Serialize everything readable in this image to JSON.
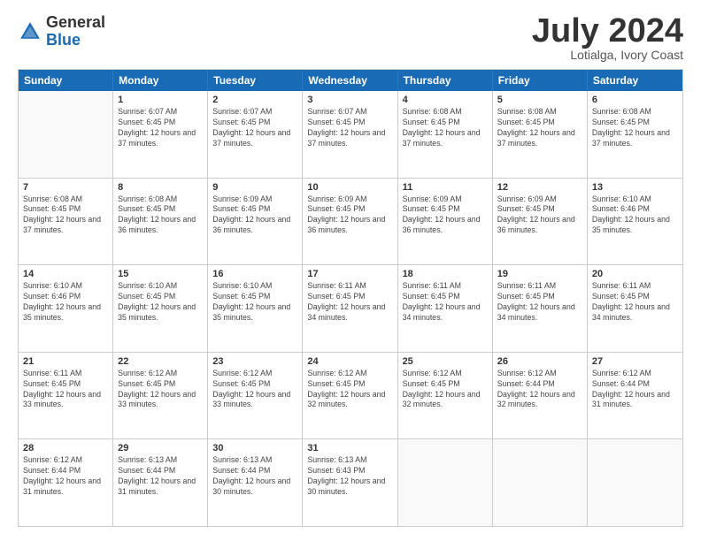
{
  "header": {
    "logo_general": "General",
    "logo_blue": "Blue",
    "month_title": "July 2024",
    "location": "Lotialga, Ivory Coast"
  },
  "calendar": {
    "days_of_week": [
      "Sunday",
      "Monday",
      "Tuesday",
      "Wednesday",
      "Thursday",
      "Friday",
      "Saturday"
    ],
    "weeks": [
      [
        {
          "day": "",
          "sunrise": "",
          "sunset": "",
          "daylight": ""
        },
        {
          "day": "1",
          "sunrise": "Sunrise: 6:07 AM",
          "sunset": "Sunset: 6:45 PM",
          "daylight": "Daylight: 12 hours and 37 minutes."
        },
        {
          "day": "2",
          "sunrise": "Sunrise: 6:07 AM",
          "sunset": "Sunset: 6:45 PM",
          "daylight": "Daylight: 12 hours and 37 minutes."
        },
        {
          "day": "3",
          "sunrise": "Sunrise: 6:07 AM",
          "sunset": "Sunset: 6:45 PM",
          "daylight": "Daylight: 12 hours and 37 minutes."
        },
        {
          "day": "4",
          "sunrise": "Sunrise: 6:08 AM",
          "sunset": "Sunset: 6:45 PM",
          "daylight": "Daylight: 12 hours and 37 minutes."
        },
        {
          "day": "5",
          "sunrise": "Sunrise: 6:08 AM",
          "sunset": "Sunset: 6:45 PM",
          "daylight": "Daylight: 12 hours and 37 minutes."
        },
        {
          "day": "6",
          "sunrise": "Sunrise: 6:08 AM",
          "sunset": "Sunset: 6:45 PM",
          "daylight": "Daylight: 12 hours and 37 minutes."
        }
      ],
      [
        {
          "day": "7",
          "sunrise": "Sunrise: 6:08 AM",
          "sunset": "Sunset: 6:45 PM",
          "daylight": "Daylight: 12 hours and 37 minutes."
        },
        {
          "day": "8",
          "sunrise": "Sunrise: 6:08 AM",
          "sunset": "Sunset: 6:45 PM",
          "daylight": "Daylight: 12 hours and 36 minutes."
        },
        {
          "day": "9",
          "sunrise": "Sunrise: 6:09 AM",
          "sunset": "Sunset: 6:45 PM",
          "daylight": "Daylight: 12 hours and 36 minutes."
        },
        {
          "day": "10",
          "sunrise": "Sunrise: 6:09 AM",
          "sunset": "Sunset: 6:45 PM",
          "daylight": "Daylight: 12 hours and 36 minutes."
        },
        {
          "day": "11",
          "sunrise": "Sunrise: 6:09 AM",
          "sunset": "Sunset: 6:45 PM",
          "daylight": "Daylight: 12 hours and 36 minutes."
        },
        {
          "day": "12",
          "sunrise": "Sunrise: 6:09 AM",
          "sunset": "Sunset: 6:45 PM",
          "daylight": "Daylight: 12 hours and 36 minutes."
        },
        {
          "day": "13",
          "sunrise": "Sunrise: 6:10 AM",
          "sunset": "Sunset: 6:46 PM",
          "daylight": "Daylight: 12 hours and 35 minutes."
        }
      ],
      [
        {
          "day": "14",
          "sunrise": "Sunrise: 6:10 AM",
          "sunset": "Sunset: 6:46 PM",
          "daylight": "Daylight: 12 hours and 35 minutes."
        },
        {
          "day": "15",
          "sunrise": "Sunrise: 6:10 AM",
          "sunset": "Sunset: 6:45 PM",
          "daylight": "Daylight: 12 hours and 35 minutes."
        },
        {
          "day": "16",
          "sunrise": "Sunrise: 6:10 AM",
          "sunset": "Sunset: 6:45 PM",
          "daylight": "Daylight: 12 hours and 35 minutes."
        },
        {
          "day": "17",
          "sunrise": "Sunrise: 6:11 AM",
          "sunset": "Sunset: 6:45 PM",
          "daylight": "Daylight: 12 hours and 34 minutes."
        },
        {
          "day": "18",
          "sunrise": "Sunrise: 6:11 AM",
          "sunset": "Sunset: 6:45 PM",
          "daylight": "Daylight: 12 hours and 34 minutes."
        },
        {
          "day": "19",
          "sunrise": "Sunrise: 6:11 AM",
          "sunset": "Sunset: 6:45 PM",
          "daylight": "Daylight: 12 hours and 34 minutes."
        },
        {
          "day": "20",
          "sunrise": "Sunrise: 6:11 AM",
          "sunset": "Sunset: 6:45 PM",
          "daylight": "Daylight: 12 hours and 34 minutes."
        }
      ],
      [
        {
          "day": "21",
          "sunrise": "Sunrise: 6:11 AM",
          "sunset": "Sunset: 6:45 PM",
          "daylight": "Daylight: 12 hours and 33 minutes."
        },
        {
          "day": "22",
          "sunrise": "Sunrise: 6:12 AM",
          "sunset": "Sunset: 6:45 PM",
          "daylight": "Daylight: 12 hours and 33 minutes."
        },
        {
          "day": "23",
          "sunrise": "Sunrise: 6:12 AM",
          "sunset": "Sunset: 6:45 PM",
          "daylight": "Daylight: 12 hours and 33 minutes."
        },
        {
          "day": "24",
          "sunrise": "Sunrise: 6:12 AM",
          "sunset": "Sunset: 6:45 PM",
          "daylight": "Daylight: 12 hours and 32 minutes."
        },
        {
          "day": "25",
          "sunrise": "Sunrise: 6:12 AM",
          "sunset": "Sunset: 6:45 PM",
          "daylight": "Daylight: 12 hours and 32 minutes."
        },
        {
          "day": "26",
          "sunrise": "Sunrise: 6:12 AM",
          "sunset": "Sunset: 6:44 PM",
          "daylight": "Daylight: 12 hours and 32 minutes."
        },
        {
          "day": "27",
          "sunrise": "Sunrise: 6:12 AM",
          "sunset": "Sunset: 6:44 PM",
          "daylight": "Daylight: 12 hours and 31 minutes."
        }
      ],
      [
        {
          "day": "28",
          "sunrise": "Sunrise: 6:12 AM",
          "sunset": "Sunset: 6:44 PM",
          "daylight": "Daylight: 12 hours and 31 minutes."
        },
        {
          "day": "29",
          "sunrise": "Sunrise: 6:13 AM",
          "sunset": "Sunset: 6:44 PM",
          "daylight": "Daylight: 12 hours and 31 minutes."
        },
        {
          "day": "30",
          "sunrise": "Sunrise: 6:13 AM",
          "sunset": "Sunset: 6:44 PM",
          "daylight": "Daylight: 12 hours and 30 minutes."
        },
        {
          "day": "31",
          "sunrise": "Sunrise: 6:13 AM",
          "sunset": "Sunset: 6:43 PM",
          "daylight": "Daylight: 12 hours and 30 minutes."
        },
        {
          "day": "",
          "sunrise": "",
          "sunset": "",
          "daylight": ""
        },
        {
          "day": "",
          "sunrise": "",
          "sunset": "",
          "daylight": ""
        },
        {
          "day": "",
          "sunrise": "",
          "sunset": "",
          "daylight": ""
        }
      ]
    ]
  }
}
